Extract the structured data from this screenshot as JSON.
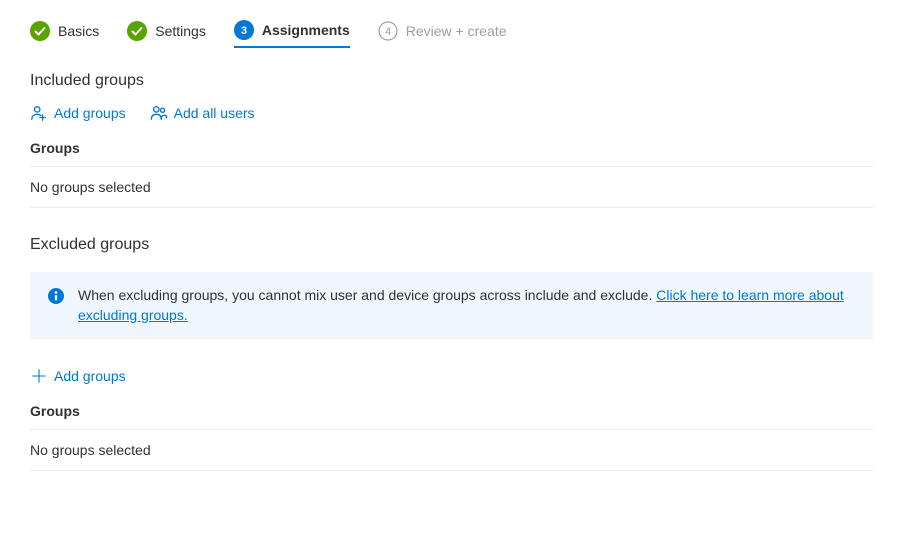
{
  "tabs": {
    "basics": "Basics",
    "settings": "Settings",
    "assignments": "Assignments",
    "assignments_step": "3",
    "review": "Review + create",
    "review_step": "4"
  },
  "included": {
    "title": "Included groups",
    "add_groups": "Add groups",
    "add_all_users": "Add all users",
    "groups_header": "Groups",
    "empty": "No groups selected"
  },
  "excluded": {
    "title": "Excluded groups",
    "info_text": "When excluding groups, you cannot mix user and device groups across include and exclude. ",
    "info_link": "Click here to learn more about excluding groups.",
    "add_groups": "Add groups",
    "groups_header": "Groups",
    "empty": "No groups selected"
  }
}
